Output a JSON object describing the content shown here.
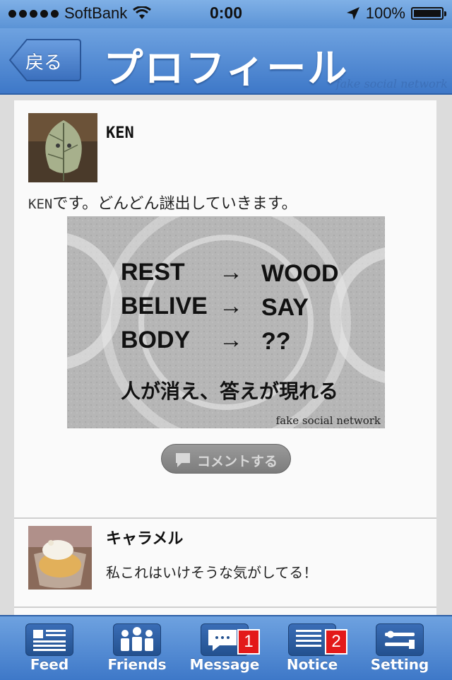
{
  "status": {
    "carrier": "SoftBank",
    "time": "0:00",
    "battery": "100%"
  },
  "nav": {
    "back_label": "戻る",
    "title": "プロフィール",
    "watermark": "fake social network"
  },
  "post": {
    "author": "KEN",
    "text_mono": "KEN",
    "text_rest": "です。どんどん謎出していきます。",
    "image": {
      "rows": [
        {
          "left": "REST",
          "arrow": "→",
          "right": "WOOD"
        },
        {
          "left": "BELIVE",
          "arrow": "→",
          "right": "SAY"
        },
        {
          "left": "BODY",
          "arrow": "→",
          "right": "??"
        }
      ],
      "caption": "人が消え、答えが現れる",
      "watermark": "fake social network"
    },
    "comment_button": "コメントする"
  },
  "comment": {
    "author": "キャラメル",
    "text": "私これはいけそうな気がしてる！"
  },
  "tabs": [
    {
      "label": "Feed",
      "icon": "feed-icon",
      "badge": ""
    },
    {
      "label": "Friends",
      "icon": "friends-icon",
      "badge": ""
    },
    {
      "label": "Message",
      "icon": "message-icon",
      "badge": "1"
    },
    {
      "label": "Notice",
      "icon": "notice-icon",
      "badge": "2"
    },
    {
      "label": "Setting",
      "icon": "setting-icon",
      "badge": ""
    }
  ],
  "colors": {
    "nav_blue": "#4a82cc",
    "badge_red": "#e31919",
    "card_bg": "#fafafa"
  }
}
